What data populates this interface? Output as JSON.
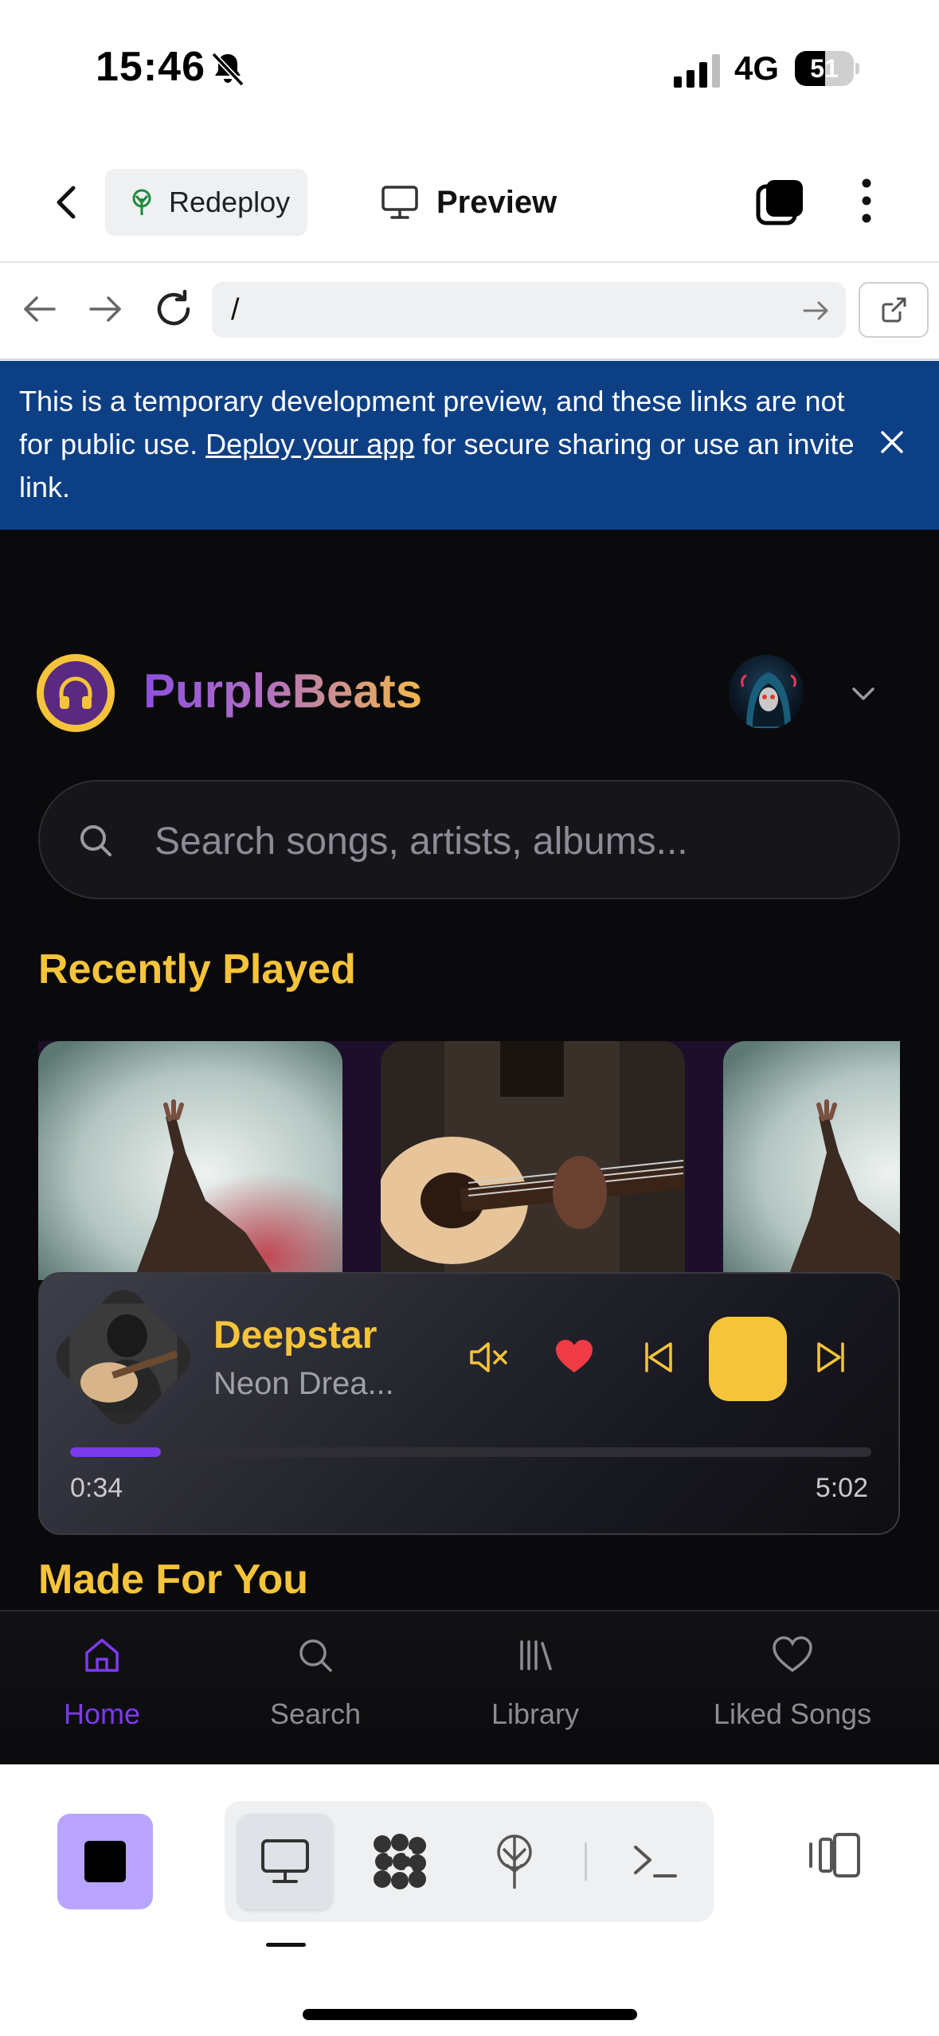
{
  "status_bar": {
    "time": "15:46",
    "network": "4G",
    "battery_level": 51,
    "battery_text": "51"
  },
  "header": {
    "redeploy_label": "Redeploy",
    "preview_label": "Preview"
  },
  "url_bar": {
    "url": "/"
  },
  "dev_banner": {
    "text_before": "This is a temporary development preview, and these links are not for public use. ",
    "link_text": "Deploy your app",
    "text_after": " for secure sharing or use an invite link."
  },
  "app": {
    "brand_name": "PurpleBeats",
    "search_placeholder": "Search songs, artists, albums...",
    "recently_played_title": "Recently Played",
    "made_for_you_title": "Made For You",
    "now_playing": {
      "title": "Deepstar",
      "artist": "Neon Drea...",
      "current_time": "0:34",
      "total_time": "5:02",
      "progress_fraction": 0.113,
      "liked": true
    },
    "bottom_nav": [
      {
        "label": "Home",
        "icon": "home-icon",
        "active": true
      },
      {
        "label": "Search",
        "icon": "search-icon",
        "active": false
      },
      {
        "label": "Library",
        "icon": "library-icon",
        "active": false
      },
      {
        "label": "Liked Songs",
        "icon": "heart-icon",
        "active": false
      }
    ]
  },
  "colors": {
    "accent_gold": "#f6c43a",
    "accent_purple": "#7c3aed",
    "banner_blue": "#0d3f85",
    "stop_button": "#b9a4ff"
  }
}
